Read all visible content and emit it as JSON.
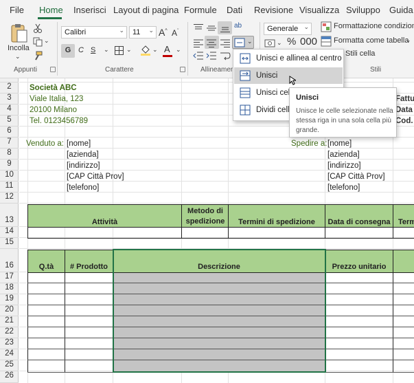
{
  "tabs": [
    "File",
    "Home",
    "Inserisci",
    "Layout di pagina",
    "Formule",
    "Dati",
    "Revisione",
    "Visualizza",
    "Sviluppo",
    "Guida"
  ],
  "active_tab": "Home",
  "ribbon": {
    "paste_label": "Incolla",
    "font_name": "Calibri",
    "font_size": "11",
    "bold": "G",
    "italic": "C",
    "underline": "S",
    "number_format": "Generale",
    "conditional_formatting": "Formattazione condizionale",
    "format_as_table": "Formatta come tabella",
    "cell_styles": "Stili cella",
    "groups": {
      "clipboard": "Appunti",
      "font": "Carattere",
      "alignment": "Allineamento",
      "styles": "Stili"
    },
    "colors": {
      "fill": "#ffd966",
      "font": "#c00000"
    }
  },
  "merge_menu": {
    "items": [
      "Unisci e allinea al centro",
      "Unisci",
      "Unisci celle",
      "Dividi celle"
    ],
    "hover_index": 1
  },
  "tooltip": {
    "title": "Unisci",
    "body": "Unisce le celle selezionate nella stessa riga in una sola cella più grande."
  },
  "row_numbers": [
    "2",
    "3",
    "4",
    "5",
    "6",
    "7",
    "8",
    "9",
    "10",
    "11",
    "12",
    "13",
    "14",
    "15",
    "16",
    "17",
    "18",
    "19",
    "20",
    "21",
    "22",
    "23",
    "24",
    "25",
    "26"
  ],
  "sheet": {
    "company": "Società ABC",
    "address": "Viale Italia, 123",
    "city": "20100 Milano",
    "phone": "Tel. 0123456789",
    "sold_to": "Venduto a:",
    "ship_to": "Spedire a:",
    "fields_left": [
      "[nome]",
      "[azienda]",
      "[indirizzo]",
      "[CAP Città Prov]",
      "[telefono]"
    ],
    "fields_right": [
      "[nome]",
      "[azienda]",
      "[indirizzo]",
      "[CAP Città Prov]",
      "[telefono]"
    ],
    "right_labels": [
      "Fattur",
      "Data",
      "Cod. C"
    ],
    "table1_headers": [
      "Attività",
      "Metodo di spedizione",
      "Termini di spedizione",
      "Data di consegna",
      "Term"
    ],
    "table2_headers": [
      "Q.tà",
      "# Prodotto",
      "Descrizione",
      "Prezzo unitario",
      ""
    ]
  }
}
